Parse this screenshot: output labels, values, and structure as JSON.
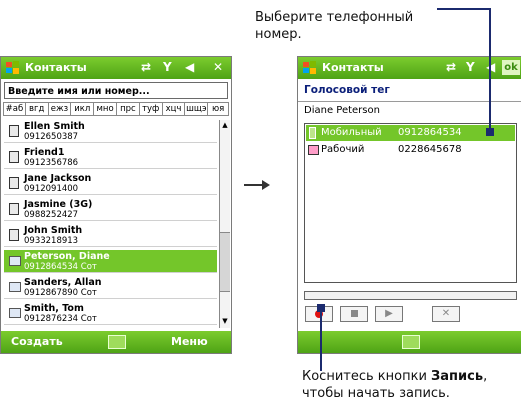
{
  "left_screen": {
    "title": "Контакты",
    "search_placeholder": "Введите имя или номер...",
    "tabs": [
      "#аб",
      "вгд",
      "ежз",
      "икл",
      "мно",
      "прс",
      "туф",
      "хцч",
      "шщэ",
      "юя"
    ],
    "contacts": [
      {
        "name": "Ellen Smith",
        "detail": "0912650387",
        "icon": "sim-card-icon"
      },
      {
        "name": "Friend1",
        "detail": "0912356786",
        "icon": "sim-card-icon"
      },
      {
        "name": "Jane Jackson",
        "detail": "0912091400",
        "icon": "sim-card-icon"
      },
      {
        "name": "Jasmine (3G)",
        "detail": "0988252427",
        "icon": "sim-card-icon"
      },
      {
        "name": "John Smith",
        "detail": "0933218913",
        "icon": "sim-card-icon"
      },
      {
        "name": "Peterson, Diane",
        "detail": "0912864534   Сот",
        "icon": "contact-card-icon",
        "selected": true
      },
      {
        "name": "Sanders, Allan",
        "detail": "0912867890   Сот",
        "icon": "contact-card-icon"
      },
      {
        "name": "Smith, Tom",
        "detail": "0912876234   Сот",
        "icon": "contact-card-icon"
      }
    ],
    "softkeys": {
      "left": "Создать",
      "right": "Меню"
    }
  },
  "right_screen": {
    "ok_label": "ok",
    "heading": "Голосовой тег",
    "contact_name": "Diane Peterson",
    "numbers": [
      {
        "label": "Мобильный",
        "value": "0912864534",
        "selected": true
      },
      {
        "label": "Рабочий",
        "value": "0228645678",
        "selected": false
      }
    ],
    "controls": [
      "record",
      "stop",
      "play",
      "delete"
    ]
  },
  "captions": {
    "top": "Выберите телефонный номер.",
    "bottom_prefix": "Коснитесь кнопки ",
    "bottom_bold": "Запись",
    "bottom_suffix": ", чтобы начать запись."
  },
  "colors": {
    "accent": "#74c62a",
    "pointer": "#1b2a6e"
  }
}
